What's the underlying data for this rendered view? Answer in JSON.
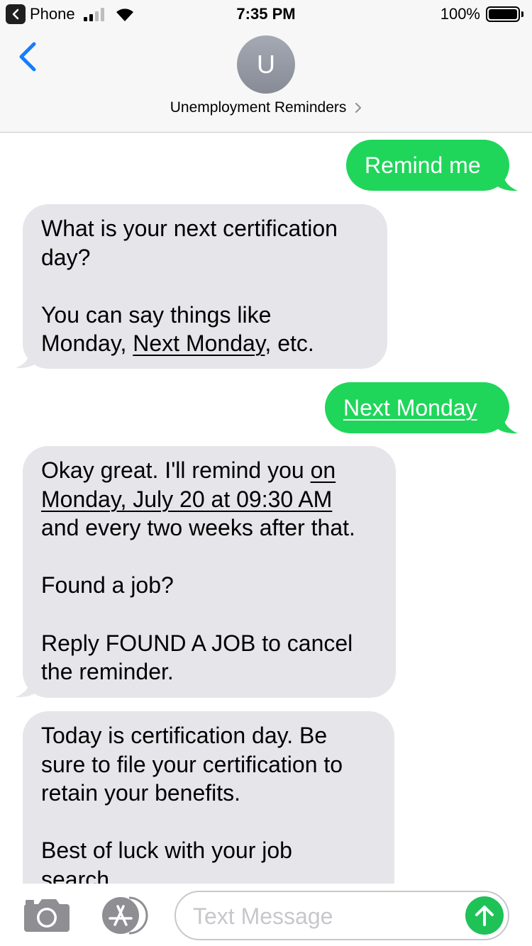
{
  "status_bar": {
    "back_app_label": "Phone",
    "time": "7:35 PM",
    "battery_percent": "100%",
    "signal_bars": 2,
    "battery_level": 1.0
  },
  "header": {
    "avatar_initial": "U",
    "contact_name": "Unemployment Reminders",
    "back_icon": "chevron-left-icon",
    "accent_color": "#147efb"
  },
  "messages": [
    {
      "direction": "outgoing",
      "lines": [
        [
          "Remind me"
        ]
      ]
    },
    {
      "direction": "incoming",
      "lines": [
        [
          "What is your next certification"
        ],
        [
          "day?"
        ],
        [],
        [
          "You can say things like"
        ],
        [
          "Monday, ",
          "Next Monday",
          ", etc."
        ]
      ]
    },
    {
      "direction": "outgoing",
      "lines": [
        [
          "Next Monday"
        ]
      ]
    },
    {
      "direction": "incoming",
      "lines": [
        [
          "Okay great. I'll remind you ",
          "on"
        ],
        [
          "Monday, July 20 at 09:30 AM"
        ],
        [
          "and every two weeks after that."
        ],
        [],
        [
          "Found a job?"
        ],
        [],
        [
          "Reply FOUND A JOB to cancel"
        ],
        [
          "the reminder."
        ]
      ]
    },
    {
      "direction": "incoming",
      "lines": [
        [
          "Today is certification day. Be"
        ],
        [
          "sure to file your certification to"
        ],
        [
          "retain your benefits."
        ],
        [],
        [
          "Best of luck with your job"
        ],
        [
          "search."
        ]
      ]
    }
  ],
  "input_bar": {
    "placeholder": "Text Message",
    "camera_icon": "camera-icon",
    "apps_icon": "app-store-icon",
    "send_icon": "send-arrow-icon"
  },
  "colors": {
    "outgoing_bubble": "#1fd65a",
    "incoming_bubble": "#e5e5ea",
    "send_button": "#1fc257"
  }
}
